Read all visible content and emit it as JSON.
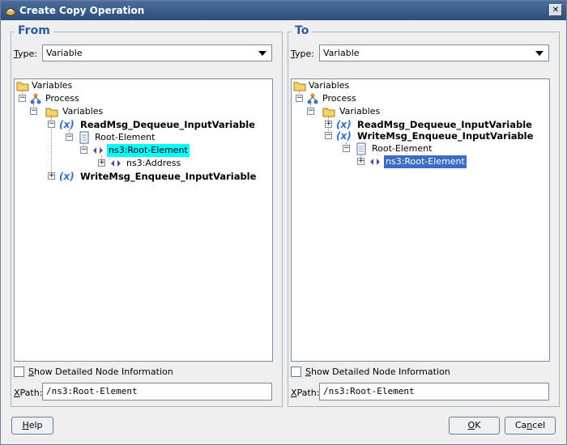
{
  "window": {
    "title": "Create Copy Operation",
    "close_glyph": "✕"
  },
  "from": {
    "legend": "From",
    "type_label": "ype:",
    "type_label_mnemonic": "T",
    "type_value": "Variable",
    "tree": {
      "variables_root": "Variables",
      "process": "Process",
      "variables": "Variables",
      "read_var": "ReadMsg_Dequeue_InputVariable",
      "root_element": "Root-Element",
      "ns3_root": "ns3:Root-Element",
      "ns3_address": "ns3:Address",
      "write_var": "WriteMsg_Enqueue_InputVariable"
    },
    "show_detail": {
      "mnemonic": "S",
      "label": "how Detailed Node Information",
      "checked": false
    },
    "xpath_label_mnemonic": "X",
    "xpath_label": "Path:",
    "xpath_value": "/ns3:Root-Element"
  },
  "to": {
    "legend": "To",
    "type_label": "ype:",
    "type_label_mnemonic": "T",
    "type_value": "Variable",
    "tree": {
      "variables_root": "Variables",
      "process": "Process",
      "variables": "Variables",
      "read_var": "ReadMsg_Dequeue_InputVariable",
      "write_var": "WriteMsg_Enqueue_InputVariable",
      "root_element": "Root-Element",
      "ns3_root": "ns3:Root-Element"
    },
    "show_detail": {
      "mnemonic": "S",
      "label": "how Detailed Node Information",
      "checked": false
    },
    "xpath_label_mnemonic": "X",
    "xpath_label": "Path:",
    "xpath_value": "/ns3:Root-Element"
  },
  "buttons": {
    "help_mnemonic": "H",
    "help_rest": "elp",
    "ok_mnemonic": "O",
    "ok_rest": "K",
    "cancel_prefix": "Ca",
    "cancel_mnemonic": "n",
    "cancel_suffix": "cel"
  },
  "colors": {
    "legend": "#2a5a9e",
    "highlight_cyan": "#00ffff",
    "highlight_blue": "#3a6ec4",
    "titlebar": "#3a5e8e"
  },
  "icons": {
    "folder": "folder-icon",
    "process": "process-icon",
    "variable": "variable-icon",
    "document": "document-icon",
    "element": "element-icon"
  }
}
